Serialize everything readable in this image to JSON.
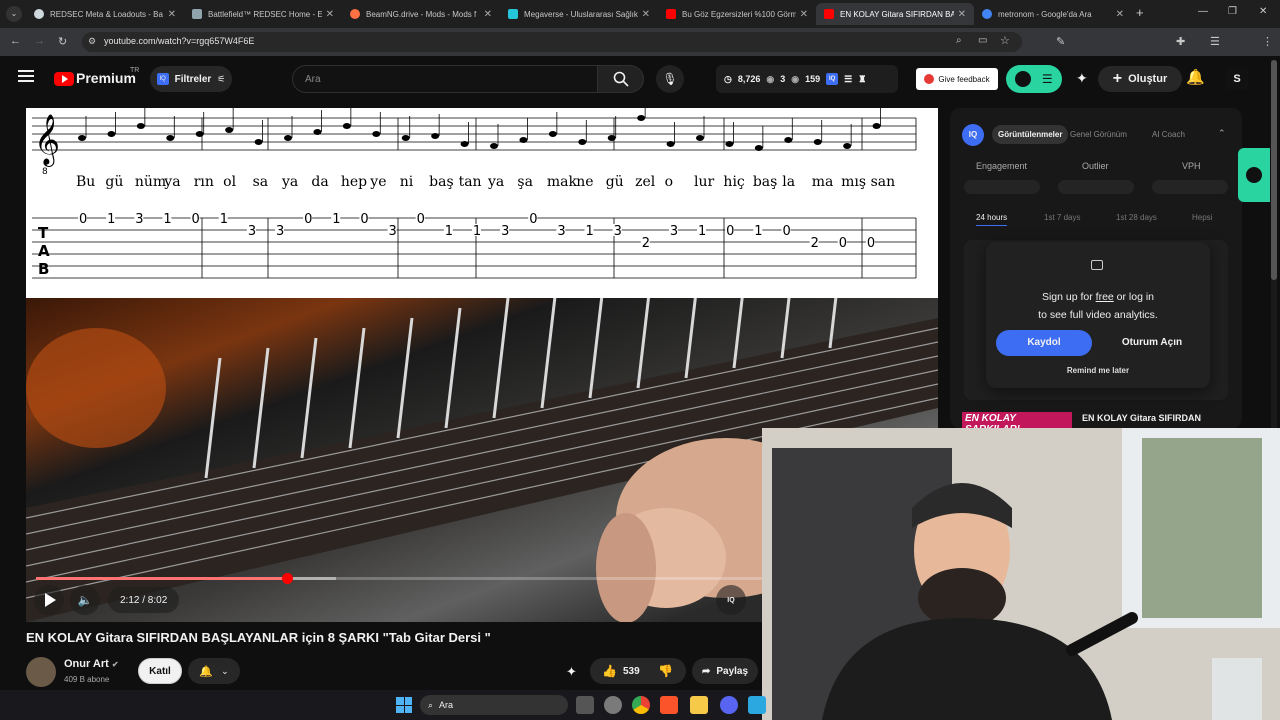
{
  "browser": {
    "tabs": [
      {
        "title": "REDSEC Meta & Loadouts - Ba",
        "color": "#cfd8dc"
      },
      {
        "title": "Battlefield™ REDSEC Home - El",
        "color": "#90a4ae"
      },
      {
        "title": "BeamNG.drive - Mods - Mods f",
        "color": "#ff7043"
      },
      {
        "title": "Megaverse - Uluslararası Sağlık",
        "color": "#26c6da"
      },
      {
        "title": "Bu Göz Egzersizleri %100 Görm",
        "color": "#ff0000"
      },
      {
        "title": "EN KOLAY Gitara SIFIRDAN BAŞ",
        "color": "#ff0000"
      },
      {
        "title": "metronom - Google'da Ara",
        "color": "#4285f4"
      }
    ],
    "new_tab": "+",
    "url": "youtube.com/watch?v=rgq657W4F6E"
  },
  "youtube": {
    "logo": "Premium",
    "region": "TR",
    "filter_label": "Filtreler",
    "search_placeholder": "Ara",
    "stats": {
      "views": "8,726",
      "a": "3",
      "b": "159"
    },
    "feedback": "Give feedback",
    "create": "Oluştur",
    "avatar_letter": "S"
  },
  "sheet": {
    "lyrics": [
      "Bu",
      "gü",
      "nüm",
      "ya",
      "rın",
      "ol",
      "sa",
      "ya",
      "da",
      "hep",
      "ye",
      "ni",
      "baş",
      "tan",
      "ya",
      "şa",
      "mak",
      "ne",
      "gü",
      "zel",
      "o",
      "lur",
      "hiç",
      "baş",
      "la",
      "ma",
      "mış",
      "san"
    ],
    "tab_numbers": [
      "0",
      "1",
      "3",
      "1",
      "0",
      "1",
      "3",
      "3",
      "0",
      "1",
      "0",
      "3",
      "0",
      "1",
      "1",
      "3",
      "0",
      "3",
      "1",
      "3",
      "2",
      "3",
      "1",
      "0",
      "1",
      "0",
      "2",
      "0",
      "0"
    ],
    "clef_sub": "8"
  },
  "player": {
    "time": "2:12 / 8:02",
    "progress": 0.281,
    "buffered": 0.336
  },
  "video": {
    "title": "EN KOLAY Gitara SIFIRDAN BAŞLAYANLAR için 8 ŞARKI \"Tab Gitar Dersi \"",
    "channel": "Onur Art",
    "subscribers": "409 B abone",
    "join": "Katıl",
    "likes": "539",
    "share": "Paylaş"
  },
  "panel": {
    "tabs": [
      "Görüntülenmeler",
      "Genel Görünüm",
      "AI Coach"
    ],
    "metrics": [
      "Engagement",
      "Outlier",
      "VPH"
    ],
    "ranges": [
      "24 hours",
      "1st 7 days",
      "1st 28 days",
      "Hepsi"
    ],
    "popup_line1_a": "Sign up for ",
    "popup_free": "free",
    "popup_line1_b": " or log in",
    "popup_line2": "to see full video analytics.",
    "signup": "Kaydol",
    "login": "Oturum Açın",
    "remind": "Remind me later",
    "next_banner": "EN KOLAY ŞARKILAR!",
    "next_title": "EN KOLAY Gitara SIFIRDAN",
    "badge": "IQ"
  },
  "taskbar": {
    "search": "Ara"
  }
}
